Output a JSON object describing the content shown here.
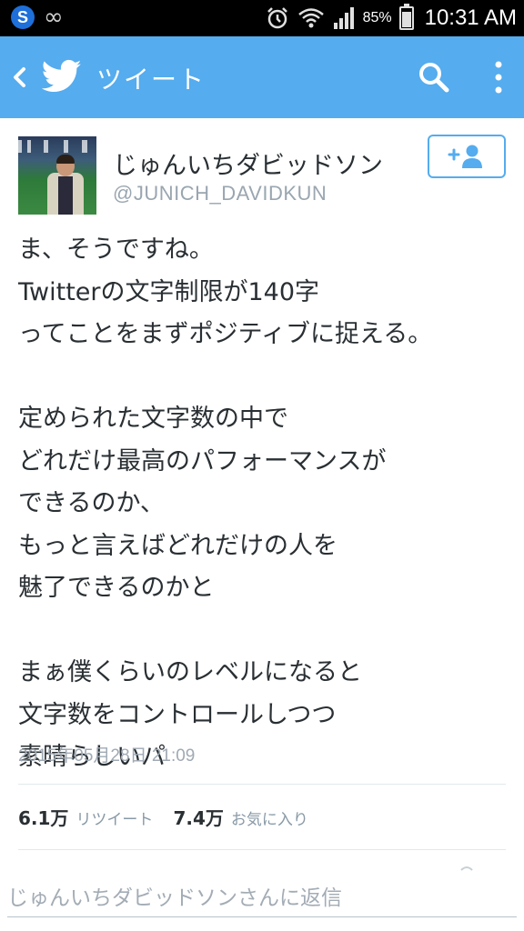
{
  "status_bar": {
    "battery_percent": "85%",
    "battery_level": 0.85,
    "time": "10:31 AM"
  },
  "app_bar": {
    "title": "ツイート",
    "accent_color": "#55acee"
  },
  "tweet": {
    "display_name": "じゅんいちダビッドソン",
    "screen_name": "@JUNICH_DAVIDKUN",
    "lines": [
      "ま、そうですね。",
      "Twitterの文字制限が140字",
      "ってことをまずポジティブに捉える。",
      "",
      "定められた文字数の中で",
      "どれだけ最高のパフォーマンスが",
      "できるのか、",
      "もっと言えばどれだけの人を",
      "魅了できるのかと",
      "",
      "まぁ僕くらいのレベルになると",
      "文字数をコントロールしつつ",
      "素晴らしいパ"
    ],
    "date": "2015年05月28日 21:09",
    "stats": {
      "retweet_count": "6.1万",
      "retweet_label": "リツイート",
      "favorite_count": "7.4万",
      "favorite_label": "お気に入り"
    }
  },
  "reply": {
    "placeholder": "じゅんいちダビッドソンさんに返信"
  },
  "icons": {
    "status_left": [
      "s-notification-icon",
      "infinity-icon"
    ],
    "status_right": [
      "alarm-icon",
      "wifi-icon",
      "signal-icon",
      "battery-icon"
    ],
    "app_bar": [
      "back-icon",
      "twitter-bird-icon",
      "search-icon",
      "overflow-menu-icon"
    ],
    "follow": "add-user-icon"
  }
}
